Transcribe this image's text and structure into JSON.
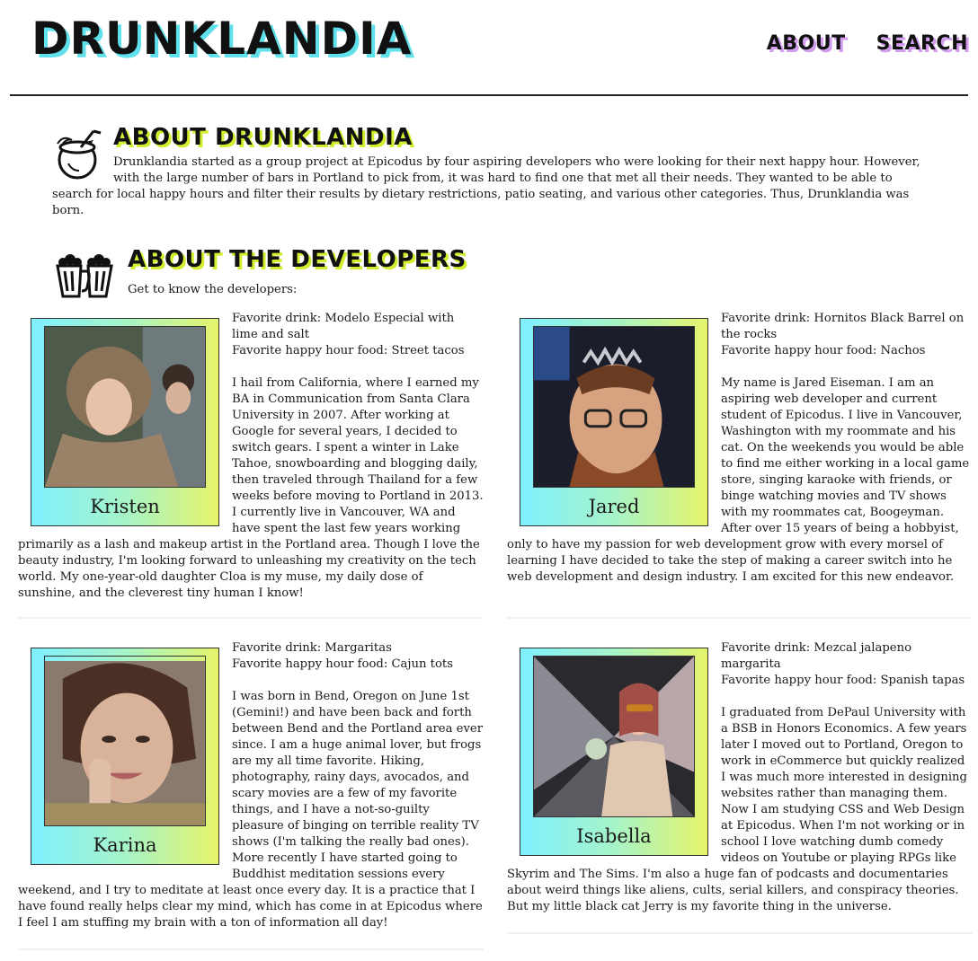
{
  "header": {
    "logo": "DRUNKLANDIA",
    "nav": [
      "ABOUT",
      "SEARCH"
    ]
  },
  "about": {
    "title": "ABOUT DRUNKLANDIA",
    "text": "Drunklandia started as a group project at Epicodus by four aspiring developers who were looking for their next happy hour. However, with the large number of bars in Portland to pick from, it was hard to find one that met all their needs. They wanted to be able to search for local happy hours and filter their results by dietary restrictions, patio seating, and various other categories. Thus, Drunklandia was born."
  },
  "developers": {
    "title": "ABOUT THE DEVELOPERS",
    "subtitle": "Get to know the developers:",
    "list": [
      {
        "name": "Kristen",
        "drink": "Favorite drink: Modelo Especial with lime and salt",
        "food": "Favorite happy hour food: Street tacos",
        "bio": "I hail from California, where I earned my BA in Communication from Santa Clara University in 2007. After working at Google for several years, I decided to switch gears. I spent a winter in Lake Tahoe, snowboarding and blogging daily, then traveled through Thailand for a few weeks before moving to Portland in 2013. I currently live in Vancouver, WA and have spent the last few years working primarily as a lash and makeup artist in the Portland area. Though I love the beauty industry, I'm looking forward to unleashing my creativity on the tech world. My one-year-old daughter Cloa is my muse, my daily dose of sunshine, and the cleverest tiny human I know!"
      },
      {
        "name": "Jared",
        "drink": "Favorite drink: Hornitos Black Barrel on the rocks",
        "food": "Favorite happy hour food: Nachos",
        "bio": "My name is Jared Eiseman. I am an aspiring web developer and current student of Epicodus. I live in Vancouver, Washington with my roommate and his cat. On the weekends you would be able to find me either working in a local game store, singing karaoke with friends, or binge watching movies and TV shows with my roommates cat, Boogeyman. After over 15 years of being a hobbyist, only to have my passion for web development grow with every morsel of learning I have decided to take the step of making a career switch into he web development and design industry. I am excited for this new endeavor."
      },
      {
        "name": "Karina",
        "drink": "Favorite drink: Margaritas",
        "food": "Favorite happy hour food: Cajun tots",
        "bio": "I was born in Bend, Oregon on June 1st (Gemini!) and have been back and forth between Bend and the Portland area ever since. I am a huge animal lover, but frogs are my all time favorite. Hiking, photography, rainy days, avocados, and scary movies are a few of my favorite things, and I have a not-so-guilty pleasure of binging on terrible reality TV shows (I'm talking the really bad ones). More recently I have started going to Buddhist meditation sessions every weekend, and I try to meditate at least once every day. It is a practice that I have found really helps clear my mind, which has come in at Epicodus where I feel I am stuffing my brain with a ton of information all day!"
      },
      {
        "name": "Isabella",
        "drink": "Favorite drink: Mezcal jalapeno margarita",
        "food": "Favorite happy hour food: Spanish tapas",
        "bio": "I graduated from DePaul University with a BSB in Honors Economics. A few years later I moved out to Portland, Oregon to work in eCommerce but quickly realized I was much more interested in designing websites rather than managing them. Now I am studying CSS and Web Design at Epicodus. When I'm not working or in school I love watching dumb comedy videos on Youtube or playing RPGs like Skyrim and The Sims. I'm also a huge fan of podcasts and documentaries about weird things like aliens, cults, serial killers, and conspiracy theories. But my little black cat Jerry is my favorite thing in the universe."
      }
    ]
  }
}
